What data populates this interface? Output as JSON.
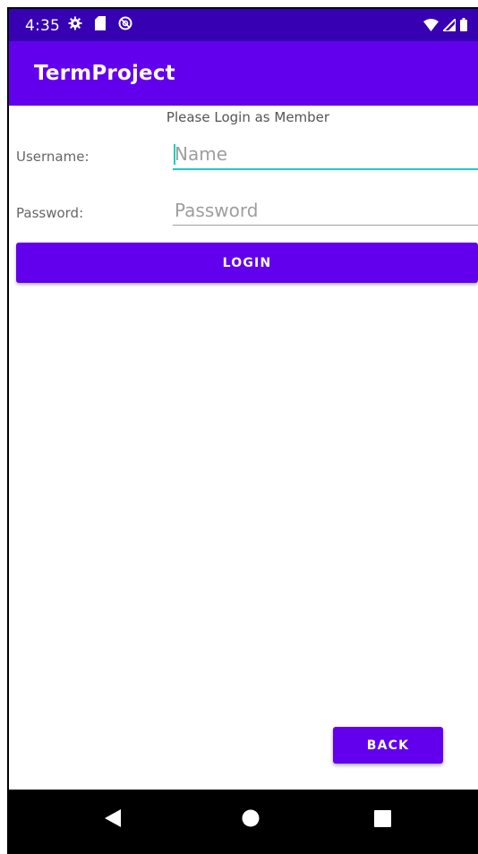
{
  "status_bar": {
    "time": "4:35",
    "left_icons": [
      "settings-icon",
      "sd-card-icon",
      "sync-icon"
    ],
    "right_icons": [
      "wifi-icon",
      "signal-icon",
      "battery-icon"
    ]
  },
  "app_bar": {
    "title": "TermProject"
  },
  "login_form": {
    "prompt": "Please Login as Member",
    "username_label": "Username:",
    "username_value": "",
    "username_placeholder": "Name",
    "password_label": "Password:",
    "password_value": "",
    "password_placeholder": "Password",
    "login_label": "LOGIN"
  },
  "footer": {
    "back_label": "BACK"
  },
  "nav_bar": {
    "icons": [
      "back-triangle-icon",
      "home-circle-icon",
      "recents-square-icon"
    ]
  },
  "colors": {
    "status_bar": "#3700b3",
    "primary": "#6200ee",
    "accent": "#1ccdc0",
    "on_primary": "#ffffff"
  }
}
